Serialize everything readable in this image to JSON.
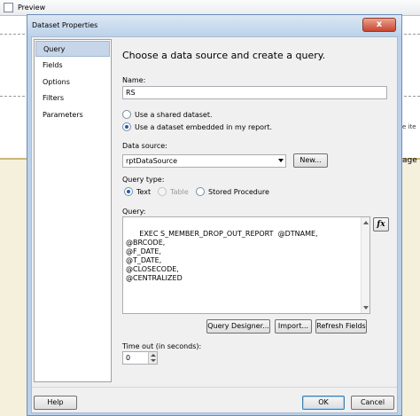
{
  "background_app": {
    "toolbar_label": "Preview",
    "side_text_1": "e ite",
    "side_text_2": "age"
  },
  "dialog": {
    "title": "Dataset Properties",
    "close_label": "x"
  },
  "nav": {
    "items": [
      {
        "label": "Query",
        "selected": true
      },
      {
        "label": "Fields"
      },
      {
        "label": "Options"
      },
      {
        "label": "Filters"
      },
      {
        "label": "Parameters"
      }
    ]
  },
  "main": {
    "heading": "Choose a data source and create a query.",
    "name_label": "Name:",
    "name_value": "RS",
    "radio_shared": "Use a shared dataset.",
    "radio_embedded": "Use a dataset embedded in my report.",
    "data_source_label": "Data source:",
    "data_source_value": "rptDataSource",
    "new_button": "New...",
    "query_type_label": "Query type:",
    "qt_text": "Text",
    "qt_table": "Table",
    "qt_stored": "Stored Procedure",
    "query_label": "Query:",
    "query_text": "EXEC S_MEMBER_DROP_OUT_REPORT  @DTNAME,\n@BRCODE,\n@F_DATE,\n@T_DATE,\n@CLOSECODE,\n@CENTRALIZED",
    "fx_label": "fx",
    "query_designer_button": "Query Designer...",
    "import_button": "Import...",
    "refresh_fields_button": "Refresh Fields",
    "timeout_label": "Time out (in seconds):",
    "timeout_value": "0"
  },
  "footer": {
    "help_button": "Help",
    "ok_button": "OK",
    "cancel_button": "Cancel"
  }
}
